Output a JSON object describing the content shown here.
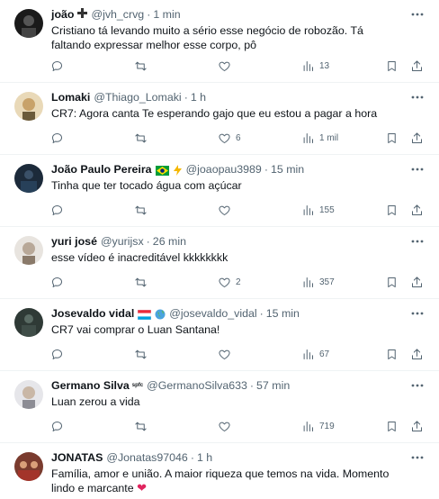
{
  "tweets": [
    {
      "name": "joão",
      "handle": "@jvh_crvg",
      "time": "1 min",
      "text": "Cristiano tá levando muito a sério esse negócio de robozão. Tá faltando expressar melhor esse corpo, pô",
      "likes": "",
      "views": "13",
      "avatar_color": "#1a1a1a"
    },
    {
      "name": "Lomaki",
      "handle": "@Thiago_Lomaki",
      "time": "1 h",
      "text": "CR7: Agora canta Te esperando gajo que eu estou a pagar a hora",
      "likes": "6",
      "views": "1 mil",
      "avatar_color": "#c8a26a"
    },
    {
      "name": "João Paulo Pereira",
      "handle": "@joaopau3989",
      "time": "15 min",
      "text": "Tinha que ter tocado água com açúcar",
      "likes": "",
      "views": "155",
      "avatar_color": "#1c2a3a"
    },
    {
      "name": "yuri josé",
      "handle": "@yurijsx",
      "time": "26 min",
      "text": "esse vídeo é inacreditável kkkkkkkk",
      "likes": "2",
      "views": "357",
      "avatar_color": "#d9d4cf"
    },
    {
      "name": "Josevaldo vidal",
      "handle": "@josevaldo_vidal",
      "time": "15 min",
      "text": "CR7 vai comprar o Luan Santana!",
      "likes": "",
      "views": "67",
      "avatar_color": "#2f3a36"
    },
    {
      "name": "Germano Silva",
      "badge": "spfc",
      "handle": "@GermanoSilva633",
      "time": "57 min",
      "text": "Luan zerou a vida",
      "likes": "",
      "views": "719",
      "avatar_color": "#d8d8dc"
    },
    {
      "name": "JONATAS",
      "handle": "@Jonatas97046",
      "time": "1 h",
      "text": "Família, amor e união. A maior riqueza que temos na vida. Momento lindo e marcante",
      "heart": "❤",
      "avatar_color": "#7a3b2e"
    }
  ],
  "colors": {
    "text_primary": "#0f1419",
    "text_secondary": "#536471",
    "divider": "#eff3f4",
    "heart": "#e0245e"
  },
  "icons": [
    "reply-icon",
    "retweet-icon",
    "like-icon",
    "views-icon",
    "bookmark-icon",
    "share-icon",
    "more-icon"
  ]
}
